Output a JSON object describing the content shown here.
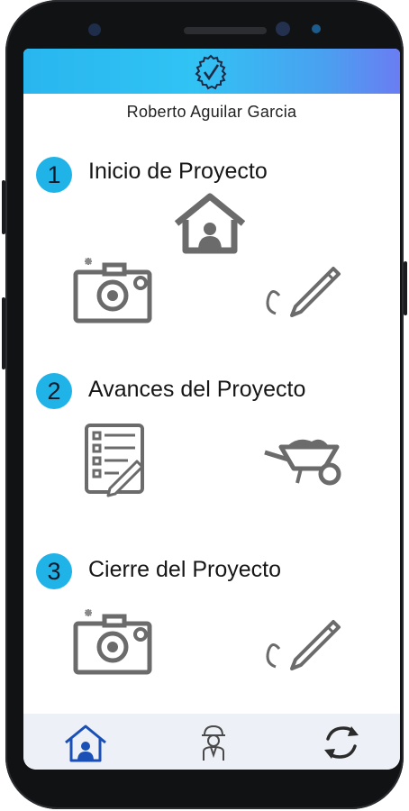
{
  "header": {
    "logo_icon": "clock-check-icon",
    "accent": "#29b6ef"
  },
  "user": {
    "name": "Roberto Aguilar Garcia"
  },
  "sections": [
    {
      "number": "1",
      "title": "Inicio de Proyecto",
      "icons": [
        "house-icon",
        "camera-icon",
        "signature-pencil-icon"
      ]
    },
    {
      "number": "2",
      "title": "Avances del Proyecto",
      "icons": [
        "checklist-document-icon",
        "wheelbarrow-icon"
      ]
    },
    {
      "number": "3",
      "title": "Cierre del Proyecto",
      "icons": [
        "camera-icon",
        "signature-pencil-icon"
      ]
    }
  ],
  "bottom_nav": {
    "items": [
      {
        "icon": "home-user-icon",
        "active": true
      },
      {
        "icon": "worker-icon",
        "active": false
      },
      {
        "icon": "refresh-icon",
        "active": false
      }
    ],
    "active_color": "#1a4fb5"
  }
}
